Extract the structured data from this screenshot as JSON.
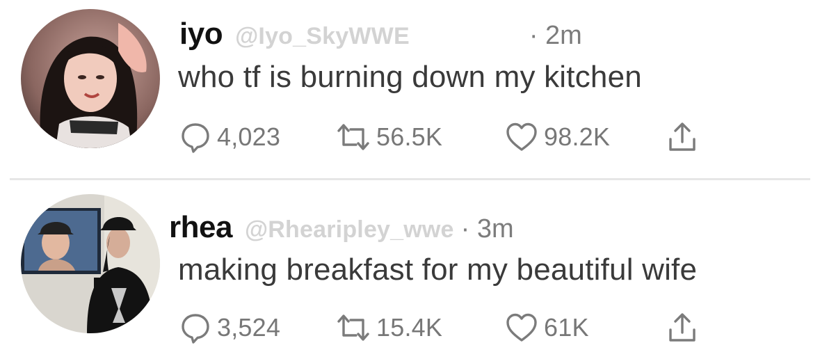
{
  "tweets": [
    {
      "name": "iyo",
      "handle": "@Iyo_SkyWWE",
      "time": "· 2m",
      "text": "who tf is burning down my kitchen",
      "replies": "4,023",
      "retweets": "56.5K",
      "likes": "98.2K"
    },
    {
      "name": "rhea",
      "handle": "@Rhearipley_wwe",
      "time": "· 3m",
      "text": "making breakfast for my beautiful wife",
      "replies": "3,524",
      "retweets": "15.4K",
      "likes": "61K"
    }
  ],
  "icons": {
    "reply": "speech-bubble-icon",
    "retweet": "retweet-arrows-icon",
    "like": "heart-icon",
    "share": "share-upload-icon"
  },
  "colors": {
    "name": "#111111",
    "handle": "#d3d3d3",
    "meta": "#7c7c7c",
    "text": "#3a3a3a",
    "divider": "#e6e6e6"
  }
}
